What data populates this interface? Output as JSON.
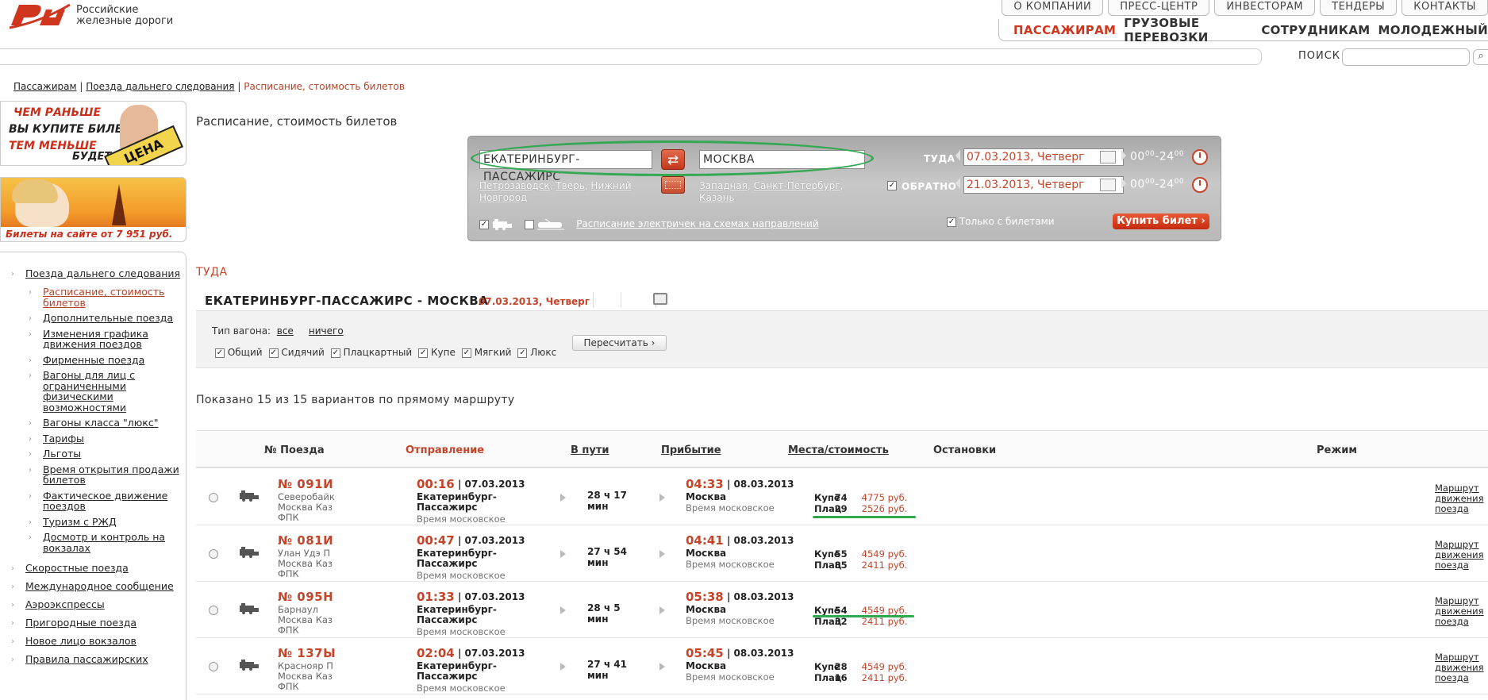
{
  "logo": {
    "text": "Российские\nжелезные дороги"
  },
  "top_nav": [
    "О КОМПАНИИ",
    "ПРЕСС-ЦЕНТР",
    "ИНВЕСТОРАМ",
    "ТЕНДЕРЫ",
    "КОНТАКТЫ"
  ],
  "main_nav": {
    "active": "ПАССАЖИРАМ",
    "items": [
      "ГРУЗОВЫЕ ПЕРЕВОЗКИ",
      "СОТРУДНИКАМ",
      "МОЛОДЕЖНЫЙ"
    ]
  },
  "search": {
    "label": "ПОИСК",
    "value": ""
  },
  "breadcrumb": {
    "items": [
      "Пассажирам",
      "Поезда дальнего следования"
    ],
    "sep": "|",
    "current": "Расписание, стоимость билетов"
  },
  "banner1": {
    "line1": "ЧЕМ РАНЬШЕ",
    "line2": "ВЫ КУПИТЕ БИЛЕТ,",
    "line3": "ТЕМ МЕНЬШЕ",
    "line4": "БУДЕТ",
    "sign": "ЦЕНА"
  },
  "banner2": {
    "caption": "Билеты на сайте от 7 951 руб."
  },
  "sidebar": {
    "items": [
      {
        "label": "Поезда дальнего следования",
        "children": [
          {
            "label": "Расписание, стоимость билетов",
            "current": true
          },
          {
            "label": "Дополнительные поезда"
          },
          {
            "label": "Изменения графика движения поездов"
          },
          {
            "label": "Фирменные поезда"
          },
          {
            "label": "Вагоны для лиц с ограниченными физическими возможностями"
          },
          {
            "label": "Вагоны класса \"люкс\""
          },
          {
            "label": "Тарифы"
          },
          {
            "label": "Льготы"
          },
          {
            "label": "Время открытия продажи билетов"
          },
          {
            "label": "Фактическое движение поездов"
          },
          {
            "label": "Туризм с РЖД"
          },
          {
            "label": "Досмотр и контроль на вокзалах"
          }
        ]
      },
      {
        "label": "Скоростные поезда"
      },
      {
        "label": "Международное сообщение"
      },
      {
        "label": "Аэроэкспрессы"
      },
      {
        "label": "Пригородные поезда"
      },
      {
        "label": "Новое лицо вокзалов"
      },
      {
        "label": "Правила пассажирских"
      }
    ]
  },
  "page": {
    "title": "Расписание, стоимость билетов"
  },
  "panel": {
    "from": "ЕКАТЕРИНБУРГ-ПАССАЖИРС",
    "to": "МОСКВА",
    "from_links": [
      "Петрозаводск",
      "Тверь",
      "Нижний Новгород"
    ],
    "to_links": [
      "Западная",
      "Санкт-Петербург",
      "Казань"
    ],
    "there_label": "ТУДА",
    "there_date": "07.03.2013, Четверг",
    "back_label": "ОБРАТНО",
    "back_date": "21.03.2013, Четверг",
    "time_from": "00",
    "time_to": "24",
    "time_sup": "00",
    "elektr_link": "Расписание электричек на схемах направлений",
    "only_tickets": "Только с билетами",
    "buy": "Купить билет"
  },
  "direction": "ТУДА",
  "route": {
    "title": "ЕКАТЕРИНБУРГ-ПАССАЖИРС - МОСКВА",
    "date": "07.03.2013, Четверг"
  },
  "filter": {
    "label": "Тип вагона:",
    "all": "все",
    "none": "ничего",
    "types": [
      "Общий",
      "Сидячий",
      "Плацкартный",
      "Купе",
      "Мягкий",
      "Люкс"
    ],
    "recalc": "Пересчитать"
  },
  "count_text": "Показано 15 из 15 вариантов по прямому маршруту",
  "table": {
    "headers": {
      "train": "№ Поезда",
      "departure": "Отправление",
      "enroute": "В пути",
      "arrival": "Прибытие",
      "seats": "Места/стоимость",
      "stops": "Остановки",
      "mode": "Режим"
    },
    "rows": [
      {
        "num": "№ 091И",
        "sub1": "Северобайк",
        "sub2": "Москва Каз",
        "sub3": "ФПК",
        "dep_time": "00:16",
        "dep_date": "| 07.03.2013",
        "dep_st1": "Екатеринбург-",
        "dep_st2": "Пассажирс",
        "dep_tz": "Время московское",
        "dur1": "28 ч 17",
        "dur2": "мин",
        "arr_time": "04:33",
        "arr_date": "| 08.03.2013",
        "arr_st": "Москва",
        "arr_tz": "Время московское",
        "seats": [
          {
            "type": "Купе",
            "count": "74",
            "price": "4775 руб."
          },
          {
            "type": "Плац",
            "count": "29",
            "price": "2526 руб."
          }
        ],
        "mode1": "Маршрут",
        "mode2": "движения",
        "mode3": "поезда"
      },
      {
        "num": "№ 081И",
        "sub1": "Улан Удэ П",
        "sub2": "Москва Каз",
        "sub3": "ФПК",
        "dep_time": "00:47",
        "dep_date": "| 07.03.2013",
        "dep_st1": "Екатеринбург-",
        "dep_st2": "Пассажирс",
        "dep_tz": "Время московское",
        "dur1": "27 ч 54",
        "dur2": "мин",
        "arr_time": "04:41",
        "arr_date": "| 08.03.2013",
        "arr_st": "Москва",
        "arr_tz": "Время московское",
        "seats": [
          {
            "type": "Купе",
            "count": "55",
            "price": "4549 руб."
          },
          {
            "type": "Плац",
            "count": "85",
            "price": "2411 руб."
          }
        ],
        "mode1": "Маршрут",
        "mode2": "движения",
        "mode3": "поезда"
      },
      {
        "num": "№ 095Н",
        "sub1": "Барнаул",
        "sub2": "Москва Каз",
        "sub3": "ФПК",
        "dep_time": "01:33",
        "dep_date": "| 07.03.2013",
        "dep_st1": "Екатеринбург-",
        "dep_st2": "Пассажирс",
        "dep_tz": "Время московское",
        "dur1": "28 ч 5 мин",
        "dur2": "",
        "arr_time": "05:38",
        "arr_date": "| 08.03.2013",
        "arr_st": "Москва",
        "arr_tz": "Время московское",
        "seats": [
          {
            "type": "Купе",
            "count": "54",
            "price": "4549 руб."
          },
          {
            "type": "Плац",
            "count": "32",
            "price": "2411 руб."
          }
        ],
        "mode1": "Маршрут",
        "mode2": "движения",
        "mode3": "поезда"
      },
      {
        "num": "№ 137Ы",
        "sub1": "Краснояр П",
        "sub2": "Москва Каз",
        "sub3": "ФПК",
        "dep_time": "02:04",
        "dep_date": "| 07.03.2013",
        "dep_st1": "Екатеринбург-",
        "dep_st2": "Пассажирс",
        "dep_tz": "Время московское",
        "dur1": "27 ч 41",
        "dur2": "мин",
        "arr_time": "05:45",
        "arr_date": "| 08.03.2013",
        "arr_st": "Москва",
        "arr_tz": "Время московское",
        "seats": [
          {
            "type": "Купе",
            "count": "28",
            "price": "4549 руб."
          },
          {
            "type": "Плац",
            "count": "16",
            "price": "2411 руб."
          }
        ],
        "mode1": "Маршрут",
        "mode2": "движения",
        "mode3": "поезда"
      }
    ]
  },
  "colors": {
    "accent": "#c4452a",
    "brand_red": "#d0351e",
    "highlight_green": "#34a853"
  }
}
